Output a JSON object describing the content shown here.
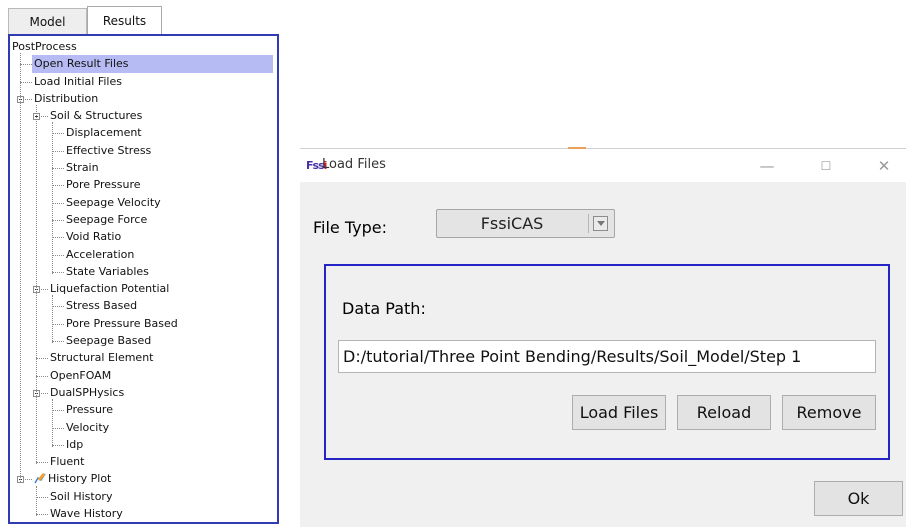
{
  "tabs": {
    "model": "Model",
    "results": "Results"
  },
  "tree": [
    {
      "label": "PostProcess",
      "depth": 0,
      "expander": false
    },
    {
      "label": "Open Result Files",
      "depth": 1,
      "expander": false,
      "selected": true
    },
    {
      "label": "Load Initial Files",
      "depth": 1,
      "expander": false
    },
    {
      "label": "Distribution",
      "depth": 1,
      "expander": true
    },
    {
      "label": "Soil & Structures",
      "depth": 2,
      "expander": true
    },
    {
      "label": "Displacement",
      "depth": 3,
      "expander": false
    },
    {
      "label": "Effective Stress",
      "depth": 3,
      "expander": false
    },
    {
      "label": "Strain",
      "depth": 3,
      "expander": false
    },
    {
      "label": "Pore Pressure",
      "depth": 3,
      "expander": false
    },
    {
      "label": "Seepage Velocity",
      "depth": 3,
      "expander": false
    },
    {
      "label": "Seepage Force",
      "depth": 3,
      "expander": false
    },
    {
      "label": "Void Ratio",
      "depth": 3,
      "expander": false
    },
    {
      "label": "Acceleration",
      "depth": 3,
      "expander": false
    },
    {
      "label": "State Variables",
      "depth": 3,
      "expander": false
    },
    {
      "label": "Liquefaction Potential",
      "depth": 2,
      "expander": true
    },
    {
      "label": "Stress Based",
      "depth": 3,
      "expander": false
    },
    {
      "label": "Pore Pressure Based",
      "depth": 3,
      "expander": false
    },
    {
      "label": "Seepage Based",
      "depth": 3,
      "expander": false
    },
    {
      "label": "Structural Element",
      "depth": 2,
      "expander": false
    },
    {
      "label": "OpenFOAM",
      "depth": 2,
      "expander": false
    },
    {
      "label": "DualSPHysics",
      "depth": 2,
      "expander": true
    },
    {
      "label": "Pressure",
      "depth": 3,
      "expander": false
    },
    {
      "label": "Velocity",
      "depth": 3,
      "expander": false
    },
    {
      "label": "Idp",
      "depth": 3,
      "expander": false
    },
    {
      "label": "Fluent",
      "depth": 2,
      "expander": false
    },
    {
      "label": "History Plot",
      "depth": 1,
      "expander": true,
      "icon": "pencil-chart-icon"
    },
    {
      "label": "Soil History",
      "depth": 2,
      "expander": false
    },
    {
      "label": "Wave History",
      "depth": 2,
      "expander": false
    }
  ],
  "dialog": {
    "title": "Load Files",
    "logo": {
      "part1": "F",
      "part2": "ss",
      "part3": "i"
    },
    "file_type_label": "File Type:",
    "file_type_value": "FssiCAS",
    "data_path_label": "Data Path:",
    "data_path_value": "D:/tutorial/Three Point Bending/Results/Soil_Model/Step 1",
    "buttons": {
      "load": "Load Files",
      "reload": "Reload",
      "remove": "Remove",
      "ok": "Ok"
    },
    "window_controls": {
      "minimize": "—",
      "maximize": "☐",
      "close": "✕"
    }
  },
  "colors": {
    "panel_border": "#2f3ab3",
    "group_border": "#2424c6",
    "selection": "#b7bbf3"
  }
}
